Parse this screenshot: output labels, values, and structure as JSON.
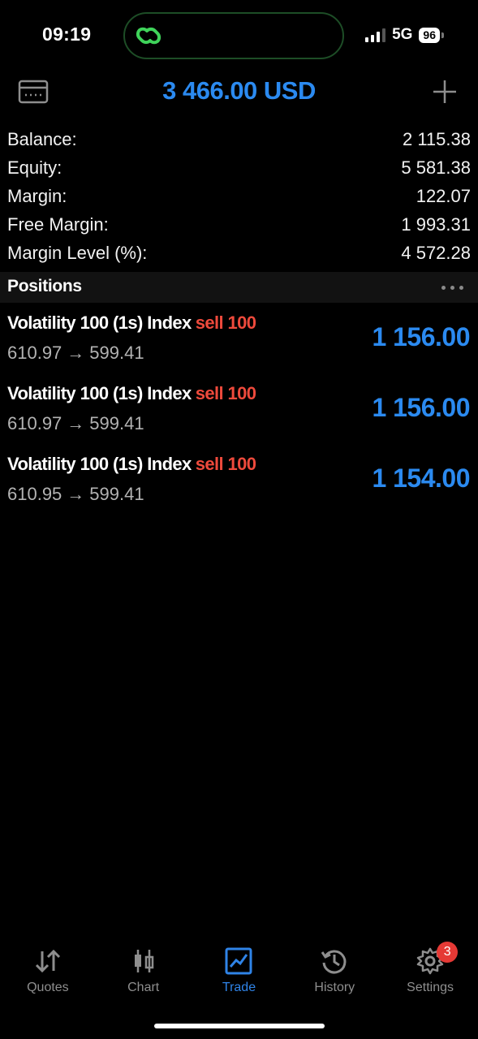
{
  "status_bar": {
    "time": "09:19",
    "network": "5G",
    "battery": "96"
  },
  "header": {
    "title": "3 466.00 USD"
  },
  "account": [
    {
      "label": "Balance:",
      "value": "2 115.38"
    },
    {
      "label": "Equity:",
      "value": "5 581.38"
    },
    {
      "label": "Margin:",
      "value": "122.07"
    },
    {
      "label": "Free Margin:",
      "value": "1 993.31"
    },
    {
      "label": "Margin Level (%):",
      "value": "4 572.28"
    }
  ],
  "positions_section": {
    "title": "Positions"
  },
  "positions": [
    {
      "symbol": "Volatility 100 (1s) Index",
      "side": "sell 100",
      "open_price": "610.97",
      "arrow": "→",
      "current_price": "599.41",
      "profit": "1 156.00"
    },
    {
      "symbol": "Volatility 100 (1s) Index",
      "side": "sell 100",
      "open_price": "610.97",
      "arrow": "→",
      "current_price": "599.41",
      "profit": "1 156.00"
    },
    {
      "symbol": "Volatility 100 (1s) Index",
      "side": "sell 100",
      "open_price": "610.95",
      "arrow": "→",
      "current_price": "599.41",
      "profit": "1 154.00"
    }
  ],
  "tabbar": {
    "items": [
      {
        "label": "Quotes",
        "icon": "quotes-icon"
      },
      {
        "label": "Chart",
        "icon": "chart-icon"
      },
      {
        "label": "Trade",
        "icon": "trade-icon",
        "active": true
      },
      {
        "label": "History",
        "icon": "history-icon"
      },
      {
        "label": "Settings",
        "icon": "settings-icon",
        "badge": "3"
      }
    ]
  },
  "colors": {
    "accent": "#2b8af0",
    "sell": "#ee4a3c",
    "badge": "#e53935"
  }
}
